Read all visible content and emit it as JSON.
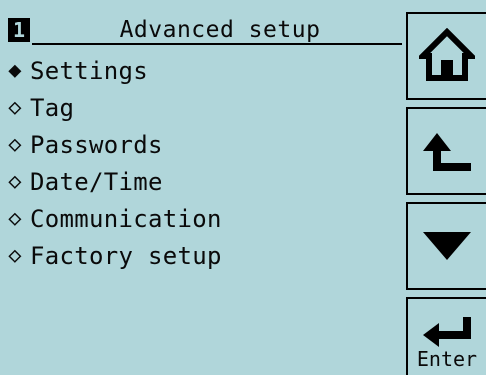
{
  "header": {
    "page_number": "1",
    "title": "Advanced setup"
  },
  "menu": {
    "items": [
      {
        "label": "Settings",
        "selected": true
      },
      {
        "label": "Tag",
        "selected": false
      },
      {
        "label": "Passwords",
        "selected": false
      },
      {
        "label": "Date/Time",
        "selected": false
      },
      {
        "label": "Communication",
        "selected": false
      },
      {
        "label": "Factory setup",
        "selected": false
      }
    ]
  },
  "softkeys": {
    "home_icon": "home-icon",
    "back_icon": "return-up-arrow-icon",
    "down_icon": "down-triangle-icon",
    "enter_icon": "enter-arrow-icon",
    "enter_label": "Enter"
  },
  "colors": {
    "screen_background": "#b0d6da",
    "foreground": "#0a0a0a"
  }
}
